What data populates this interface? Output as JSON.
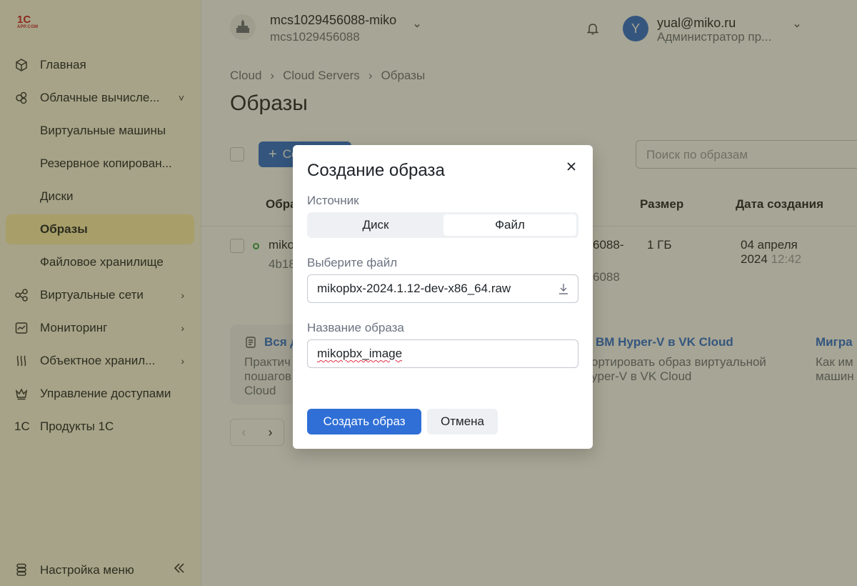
{
  "logo": {
    "line1": "1С",
    "line2": "APP.COM"
  },
  "sidebar": {
    "items": [
      {
        "label": "Главная",
        "icon": "cube-icon"
      },
      {
        "label": "Облачные вычисле...",
        "icon": "cloud-compute-icon",
        "arrow": "˅"
      },
      {
        "label": "Виртуальные машины"
      },
      {
        "label": "Резервное копирован..."
      },
      {
        "label": "Диски"
      },
      {
        "label": "Образы",
        "active": true
      },
      {
        "label": "Файловое хранилище"
      },
      {
        "label": "Виртуальные сети",
        "icon": "network-icon",
        "arrow": "›"
      },
      {
        "label": "Мониторинг",
        "icon": "chart-icon",
        "arrow": "›"
      },
      {
        "label": "Объектное хранил...",
        "icon": "storage-icon",
        "arrow": "›"
      },
      {
        "label": "Управление доступами",
        "icon": "crown-icon"
      },
      {
        "label": "Продукты 1С",
        "icon": "one-c-icon",
        "icon_text": "1С"
      }
    ],
    "settings_label": "Настройка меню"
  },
  "header": {
    "project_name": "mcs1029456088-miko",
    "project_id": "mcs1029456088",
    "user_initial": "Y",
    "user_email": "yual@miko.ru",
    "user_role": "Администратор пр..."
  },
  "breadcrumb": [
    "Cloud",
    "Cloud Servers",
    "Образы"
  ],
  "page_title": "Образы",
  "toolbar": {
    "create_label": "Создать",
    "search_placeholder": "Поиск по образам"
  },
  "table": {
    "headers": {
      "name": "Образ",
      "size": "Размер",
      "created": "Дата создания"
    },
    "row": {
      "name": "miko",
      "id_fragment": "4b18",
      "project_fragment_1": "6088-",
      "project_fragment_2": "6088",
      "size": "1 ГБ",
      "date": "04 апреля",
      "year": "2024",
      "time": "12:42"
    }
  },
  "cards": [
    {
      "title": "Вся д",
      "text": [
        "Практич",
        "пошагов",
        "Cloud"
      ]
    },
    {
      "title": "ВМ Hyper-V в VK Cloud",
      "text": [
        "ортировать образ виртуальной",
        "yper-V в VK Cloud"
      ]
    },
    {
      "title": "Мигра",
      "text": [
        "Как им",
        "машин"
      ]
    }
  ],
  "modal": {
    "title": "Создание образа",
    "source_label": "Источник",
    "source_options": [
      "Диск",
      "Файл"
    ],
    "selected_source": "Файл",
    "file_label": "Выберите файл",
    "file_value": "mikopbx-2024.1.12-dev-x86_64.raw",
    "name_label": "Название образа",
    "name_value": "mikopbx_image",
    "submit_label": "Создать образ",
    "cancel_label": "Отмена"
  },
  "colors": {
    "accent": "#2f6fd6",
    "sidebar_bg": "#fefce8",
    "active_item": "#fff3b0",
    "status_ok": "#36a24a"
  }
}
